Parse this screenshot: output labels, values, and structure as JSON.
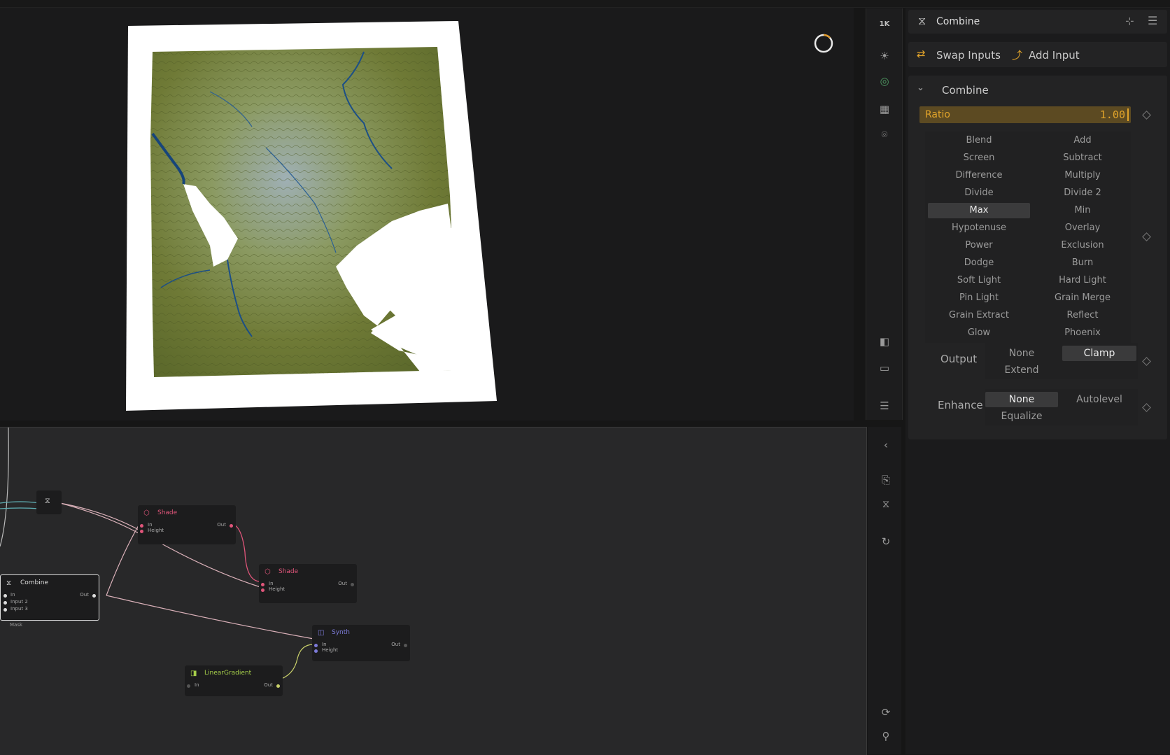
{
  "viewport": {
    "resolution_label": "1K"
  },
  "graph": {
    "nodes": [
      {
        "id": "combine-small",
        "title": "",
        "ports": []
      },
      {
        "id": "shade1",
        "title": "Shade",
        "ports": [
          "In",
          "Height"
        ],
        "out": "Out"
      },
      {
        "id": "shade2",
        "title": "Shade",
        "ports": [
          "In",
          "Height"
        ],
        "out": "Out"
      },
      {
        "id": "combine",
        "title": "Combine",
        "ports": [
          "In",
          "Input 2",
          "Input 3"
        ],
        "out": "Out",
        "extra": "Mask"
      },
      {
        "id": "synth",
        "title": "Synth",
        "ports": [
          "In",
          "Height"
        ],
        "out": "Out"
      },
      {
        "id": "lineargradient",
        "title": "LinearGradient",
        "ports": [
          "In"
        ],
        "out": "Out"
      }
    ]
  },
  "panel": {
    "header_title": "Combine",
    "swap_inputs": "Swap Inputs",
    "add_input": "Add Input",
    "section_title": "Combine",
    "ratio_label": "Ratio",
    "ratio_value": "1.00",
    "ratio_fraction": 1.0,
    "blend_modes": [
      "Blend",
      "Add",
      "Screen",
      "Subtract",
      "Difference",
      "Multiply",
      "Divide",
      "Divide 2",
      "Max",
      "Min",
      "Hypotenuse",
      "Overlay",
      "Power",
      "Exclusion",
      "Dodge",
      "Burn",
      "Soft Light",
      "Hard Light",
      "Pin Light",
      "Grain Merge",
      "Grain Extract",
      "Reflect",
      "Glow",
      "Phoenix"
    ],
    "selected_blend": "Max",
    "output_label": "Output",
    "output_options": [
      "None",
      "Clamp",
      "Extend"
    ],
    "selected_output": "Clamp",
    "enhance_label": "Enhance",
    "enhance_options": [
      "None",
      "Autolevel",
      "Equalize"
    ],
    "selected_enhance": "None"
  },
  "colors": {
    "accent_orange": "#e0a32a",
    "ratio_fill": "#5c4a22",
    "shade_node": "#e0557a",
    "synth_node": "#7d7bd9",
    "gradient_node": "#a6cf4a"
  }
}
